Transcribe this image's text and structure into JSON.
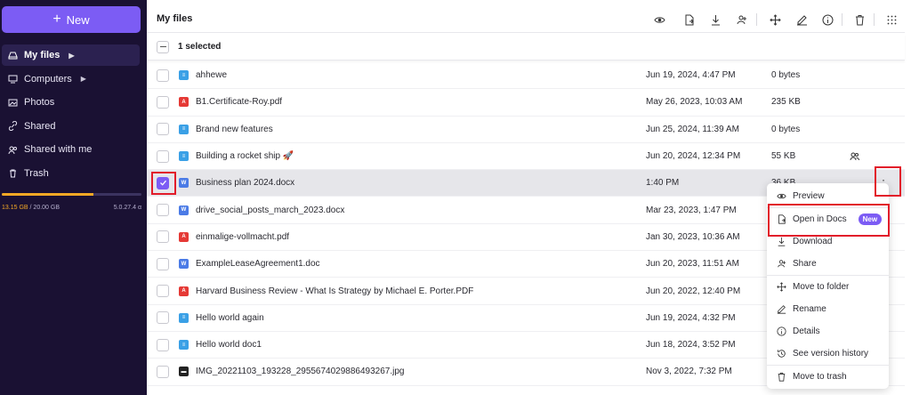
{
  "sidebar": {
    "new_label": "New",
    "items": [
      {
        "label": "My files",
        "icon": "drive-icon",
        "active": true,
        "caret": true
      },
      {
        "label": "Computers",
        "icon": "computer-icon",
        "caret": true
      },
      {
        "label": "Photos",
        "icon": "photo-icon"
      },
      {
        "label": "Shared",
        "icon": "link-icon"
      },
      {
        "label": "Shared with me",
        "icon": "users-icon"
      },
      {
        "label": "Trash",
        "icon": "trash-icon"
      }
    ],
    "storage": {
      "used": "13.15 GB",
      "separator": " / ",
      "total": "20.00 GB",
      "version": "5.0.27.4 α",
      "fraction": 0.6575
    }
  },
  "toolbar": {
    "title": "My files",
    "icons": [
      "eye-icon",
      "file-export-icon",
      "download-icon",
      "share-user-icon",
      "move-icon",
      "edit-icon",
      "info-icon",
      "trash-icon",
      "grid-icon"
    ]
  },
  "selection": {
    "label": "1 selected"
  },
  "files": [
    {
      "name": "ahhewe",
      "type": "doc",
      "date": "Jun 19, 2024, 4:47 PM",
      "size": "0 bytes"
    },
    {
      "name": "B1.Certificate-Roy.pdf",
      "type": "pdf",
      "date": "May 26, 2023, 10:03 AM",
      "size": "235 KB"
    },
    {
      "name": "Brand new features",
      "type": "doc",
      "date": "Jun 25, 2024, 11:39 AM",
      "size": "0 bytes"
    },
    {
      "name": "Building a rocket ship 🚀",
      "type": "doc",
      "date": "Jun 20, 2024, 12:34 PM",
      "size": "55 KB",
      "shared": true
    },
    {
      "name": "Business plan 2024.docx",
      "type": "word",
      "date": "1:40 PM",
      "size": "36 KB",
      "selected": true
    },
    {
      "name": "drive_social_posts_march_2023.docx",
      "type": "word",
      "date": "Mar 23, 2023, 1:47 PM",
      "size": ""
    },
    {
      "name": "einmalige-vollmacht.pdf",
      "type": "pdf",
      "date": "Jan 30, 2023, 10:36 AM",
      "size": ""
    },
    {
      "name": "ExampleLeaseAgreement1.doc",
      "type": "word",
      "date": "Jun 20, 2023, 11:51 AM",
      "size": ""
    },
    {
      "name": "Harvard Business Review - What Is Strategy by Michael E. Porter.PDF",
      "type": "pdf",
      "date": "Jun 20, 2022, 12:40 PM",
      "size": ""
    },
    {
      "name": "Hello world again",
      "type": "doc",
      "date": "Jun 19, 2024, 4:32 PM",
      "size": ""
    },
    {
      "name": "Hello world doc1",
      "type": "doc",
      "date": "Jun 18, 2024, 3:52 PM",
      "size": ""
    },
    {
      "name": "IMG_20221103_193228_2955674029886493267.jpg",
      "type": "img",
      "date": "Nov 3, 2022, 7:32 PM",
      "size": ""
    }
  ],
  "context_menu": {
    "items": [
      {
        "label": "Preview",
        "icon": "eye-icon"
      },
      {
        "label": "Open in Docs",
        "icon": "file-export-icon",
        "badge": "New"
      },
      {
        "label": "Download",
        "icon": "download-icon"
      },
      {
        "label": "Share",
        "icon": "share-user-icon"
      },
      {
        "label": "Move to folder",
        "icon": "move-icon"
      },
      {
        "label": "Rename",
        "icon": "edit-icon"
      },
      {
        "label": "Details",
        "icon": "info-icon"
      },
      {
        "label": "See version history",
        "icon": "history-icon"
      },
      {
        "label": "Move to trash",
        "icon": "trash-icon"
      }
    ]
  },
  "colors": {
    "sidebar_bg": "#1a1133",
    "accent": "#7c5cf4",
    "storage": "#f4a825",
    "highlight": "#e21c2a"
  }
}
